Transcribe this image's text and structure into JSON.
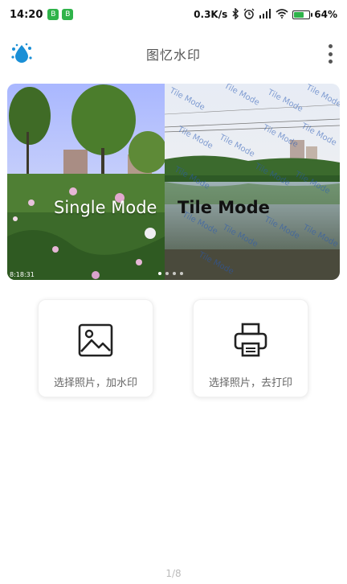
{
  "status_bar": {
    "time": "14:20",
    "badge1": "B",
    "badge2": "B",
    "speed": "0.3K/s",
    "battery_pct": "64%",
    "battery_level": 0.64
  },
  "app_bar": {
    "title": "图忆水印"
  },
  "banner": {
    "single_label": "Single Mode",
    "tile_label": "Tile Mode",
    "watermark_text": "Tile Mode",
    "timestamp": "8:18:31",
    "slide_count": 4,
    "active_slide": 0
  },
  "actions": {
    "watermark_label": "选择照片，加水印",
    "print_label": "选择照片，去打印"
  },
  "pager": {
    "text": "1/8"
  },
  "colors": {
    "accent": "#1a8fd6",
    "battery": "#2fb34a"
  }
}
